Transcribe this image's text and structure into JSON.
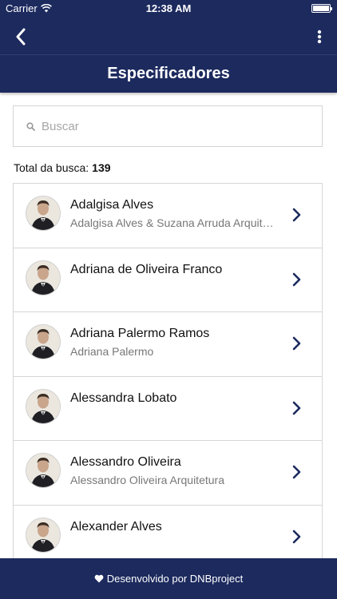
{
  "status_bar": {
    "carrier": "Carrier",
    "time": "12:38 AM"
  },
  "nav": {
    "back_icon": "chevron-left-icon",
    "menu_icon": "vertical-ellipsis-icon"
  },
  "page": {
    "title": "Especificadores"
  },
  "search": {
    "placeholder": "Buscar",
    "value": ""
  },
  "total": {
    "label": "Total da busca:",
    "count": "139"
  },
  "list": [
    {
      "name": "Adalgisa Alves",
      "subtitle": "Adalgisa Alves & Suzana Arruda Arquitetura"
    },
    {
      "name": "Adriana de Oliveira Franco",
      "subtitle": ""
    },
    {
      "name": "Adriana Palermo Ramos",
      "subtitle": "Adriana Palermo"
    },
    {
      "name": "Alessandra Lobato",
      "subtitle": ""
    },
    {
      "name": "Alessandro Oliveira",
      "subtitle": "Alessandro Oliveira Arquitetura"
    },
    {
      "name": "Alexander Alves",
      "subtitle": ""
    }
  ],
  "footer": {
    "icon": "heart-icon",
    "text": "Desenvolvido por DNBproject"
  },
  "colors": {
    "brand": "#1c2a5e",
    "chevron": "#1c2a5e"
  }
}
